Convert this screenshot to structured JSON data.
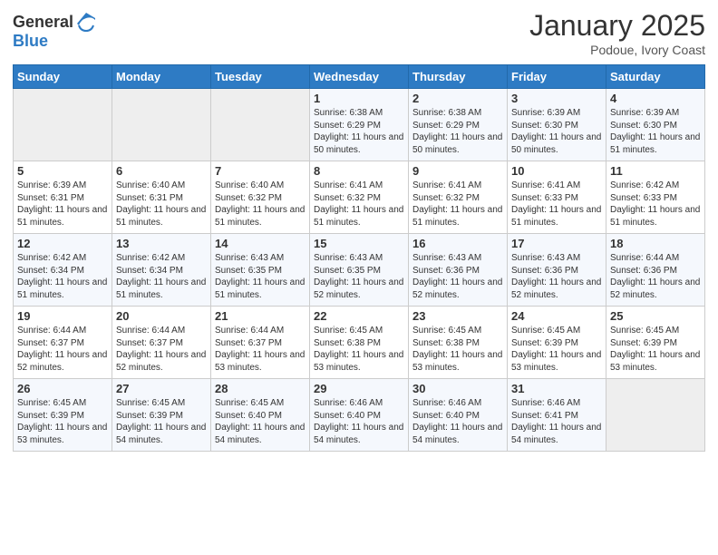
{
  "header": {
    "logo_general": "General",
    "logo_blue": "Blue",
    "month_title": "January 2025",
    "subtitle": "Podoue, Ivory Coast"
  },
  "weekdays": [
    "Sunday",
    "Monday",
    "Tuesday",
    "Wednesday",
    "Thursday",
    "Friday",
    "Saturday"
  ],
  "weeks": [
    [
      {
        "day": "",
        "sunrise": "",
        "sunset": "",
        "daylight": ""
      },
      {
        "day": "",
        "sunrise": "",
        "sunset": "",
        "daylight": ""
      },
      {
        "day": "",
        "sunrise": "",
        "sunset": "",
        "daylight": ""
      },
      {
        "day": "1",
        "sunrise": "Sunrise: 6:38 AM",
        "sunset": "Sunset: 6:29 PM",
        "daylight": "Daylight: 11 hours and 50 minutes."
      },
      {
        "day": "2",
        "sunrise": "Sunrise: 6:38 AM",
        "sunset": "Sunset: 6:29 PM",
        "daylight": "Daylight: 11 hours and 50 minutes."
      },
      {
        "day": "3",
        "sunrise": "Sunrise: 6:39 AM",
        "sunset": "Sunset: 6:30 PM",
        "daylight": "Daylight: 11 hours and 50 minutes."
      },
      {
        "day": "4",
        "sunrise": "Sunrise: 6:39 AM",
        "sunset": "Sunset: 6:30 PM",
        "daylight": "Daylight: 11 hours and 51 minutes."
      }
    ],
    [
      {
        "day": "5",
        "sunrise": "Sunrise: 6:39 AM",
        "sunset": "Sunset: 6:31 PM",
        "daylight": "Daylight: 11 hours and 51 minutes."
      },
      {
        "day": "6",
        "sunrise": "Sunrise: 6:40 AM",
        "sunset": "Sunset: 6:31 PM",
        "daylight": "Daylight: 11 hours and 51 minutes."
      },
      {
        "day": "7",
        "sunrise": "Sunrise: 6:40 AM",
        "sunset": "Sunset: 6:32 PM",
        "daylight": "Daylight: 11 hours and 51 minutes."
      },
      {
        "day": "8",
        "sunrise": "Sunrise: 6:41 AM",
        "sunset": "Sunset: 6:32 PM",
        "daylight": "Daylight: 11 hours and 51 minutes."
      },
      {
        "day": "9",
        "sunrise": "Sunrise: 6:41 AM",
        "sunset": "Sunset: 6:32 PM",
        "daylight": "Daylight: 11 hours and 51 minutes."
      },
      {
        "day": "10",
        "sunrise": "Sunrise: 6:41 AM",
        "sunset": "Sunset: 6:33 PM",
        "daylight": "Daylight: 11 hours and 51 minutes."
      },
      {
        "day": "11",
        "sunrise": "Sunrise: 6:42 AM",
        "sunset": "Sunset: 6:33 PM",
        "daylight": "Daylight: 11 hours and 51 minutes."
      }
    ],
    [
      {
        "day": "12",
        "sunrise": "Sunrise: 6:42 AM",
        "sunset": "Sunset: 6:34 PM",
        "daylight": "Daylight: 11 hours and 51 minutes."
      },
      {
        "day": "13",
        "sunrise": "Sunrise: 6:42 AM",
        "sunset": "Sunset: 6:34 PM",
        "daylight": "Daylight: 11 hours and 51 minutes."
      },
      {
        "day": "14",
        "sunrise": "Sunrise: 6:43 AM",
        "sunset": "Sunset: 6:35 PM",
        "daylight": "Daylight: 11 hours and 51 minutes."
      },
      {
        "day": "15",
        "sunrise": "Sunrise: 6:43 AM",
        "sunset": "Sunset: 6:35 PM",
        "daylight": "Daylight: 11 hours and 52 minutes."
      },
      {
        "day": "16",
        "sunrise": "Sunrise: 6:43 AM",
        "sunset": "Sunset: 6:36 PM",
        "daylight": "Daylight: 11 hours and 52 minutes."
      },
      {
        "day": "17",
        "sunrise": "Sunrise: 6:43 AM",
        "sunset": "Sunset: 6:36 PM",
        "daylight": "Daylight: 11 hours and 52 minutes."
      },
      {
        "day": "18",
        "sunrise": "Sunrise: 6:44 AM",
        "sunset": "Sunset: 6:36 PM",
        "daylight": "Daylight: 11 hours and 52 minutes."
      }
    ],
    [
      {
        "day": "19",
        "sunrise": "Sunrise: 6:44 AM",
        "sunset": "Sunset: 6:37 PM",
        "daylight": "Daylight: 11 hours and 52 minutes."
      },
      {
        "day": "20",
        "sunrise": "Sunrise: 6:44 AM",
        "sunset": "Sunset: 6:37 PM",
        "daylight": "Daylight: 11 hours and 52 minutes."
      },
      {
        "day": "21",
        "sunrise": "Sunrise: 6:44 AM",
        "sunset": "Sunset: 6:37 PM",
        "daylight": "Daylight: 11 hours and 53 minutes."
      },
      {
        "day": "22",
        "sunrise": "Sunrise: 6:45 AM",
        "sunset": "Sunset: 6:38 PM",
        "daylight": "Daylight: 11 hours and 53 minutes."
      },
      {
        "day": "23",
        "sunrise": "Sunrise: 6:45 AM",
        "sunset": "Sunset: 6:38 PM",
        "daylight": "Daylight: 11 hours and 53 minutes."
      },
      {
        "day": "24",
        "sunrise": "Sunrise: 6:45 AM",
        "sunset": "Sunset: 6:39 PM",
        "daylight": "Daylight: 11 hours and 53 minutes."
      },
      {
        "day": "25",
        "sunrise": "Sunrise: 6:45 AM",
        "sunset": "Sunset: 6:39 PM",
        "daylight": "Daylight: 11 hours and 53 minutes."
      }
    ],
    [
      {
        "day": "26",
        "sunrise": "Sunrise: 6:45 AM",
        "sunset": "Sunset: 6:39 PM",
        "daylight": "Daylight: 11 hours and 53 minutes."
      },
      {
        "day": "27",
        "sunrise": "Sunrise: 6:45 AM",
        "sunset": "Sunset: 6:39 PM",
        "daylight": "Daylight: 11 hours and 54 minutes."
      },
      {
        "day": "28",
        "sunrise": "Sunrise: 6:45 AM",
        "sunset": "Sunset: 6:40 PM",
        "daylight": "Daylight: 11 hours and 54 minutes."
      },
      {
        "day": "29",
        "sunrise": "Sunrise: 6:46 AM",
        "sunset": "Sunset: 6:40 PM",
        "daylight": "Daylight: 11 hours and 54 minutes."
      },
      {
        "day": "30",
        "sunrise": "Sunrise: 6:46 AM",
        "sunset": "Sunset: 6:40 PM",
        "daylight": "Daylight: 11 hours and 54 minutes."
      },
      {
        "day": "31",
        "sunrise": "Sunrise: 6:46 AM",
        "sunset": "Sunset: 6:41 PM",
        "daylight": "Daylight: 11 hours and 54 minutes."
      },
      {
        "day": "",
        "sunrise": "",
        "sunset": "",
        "daylight": ""
      }
    ]
  ]
}
